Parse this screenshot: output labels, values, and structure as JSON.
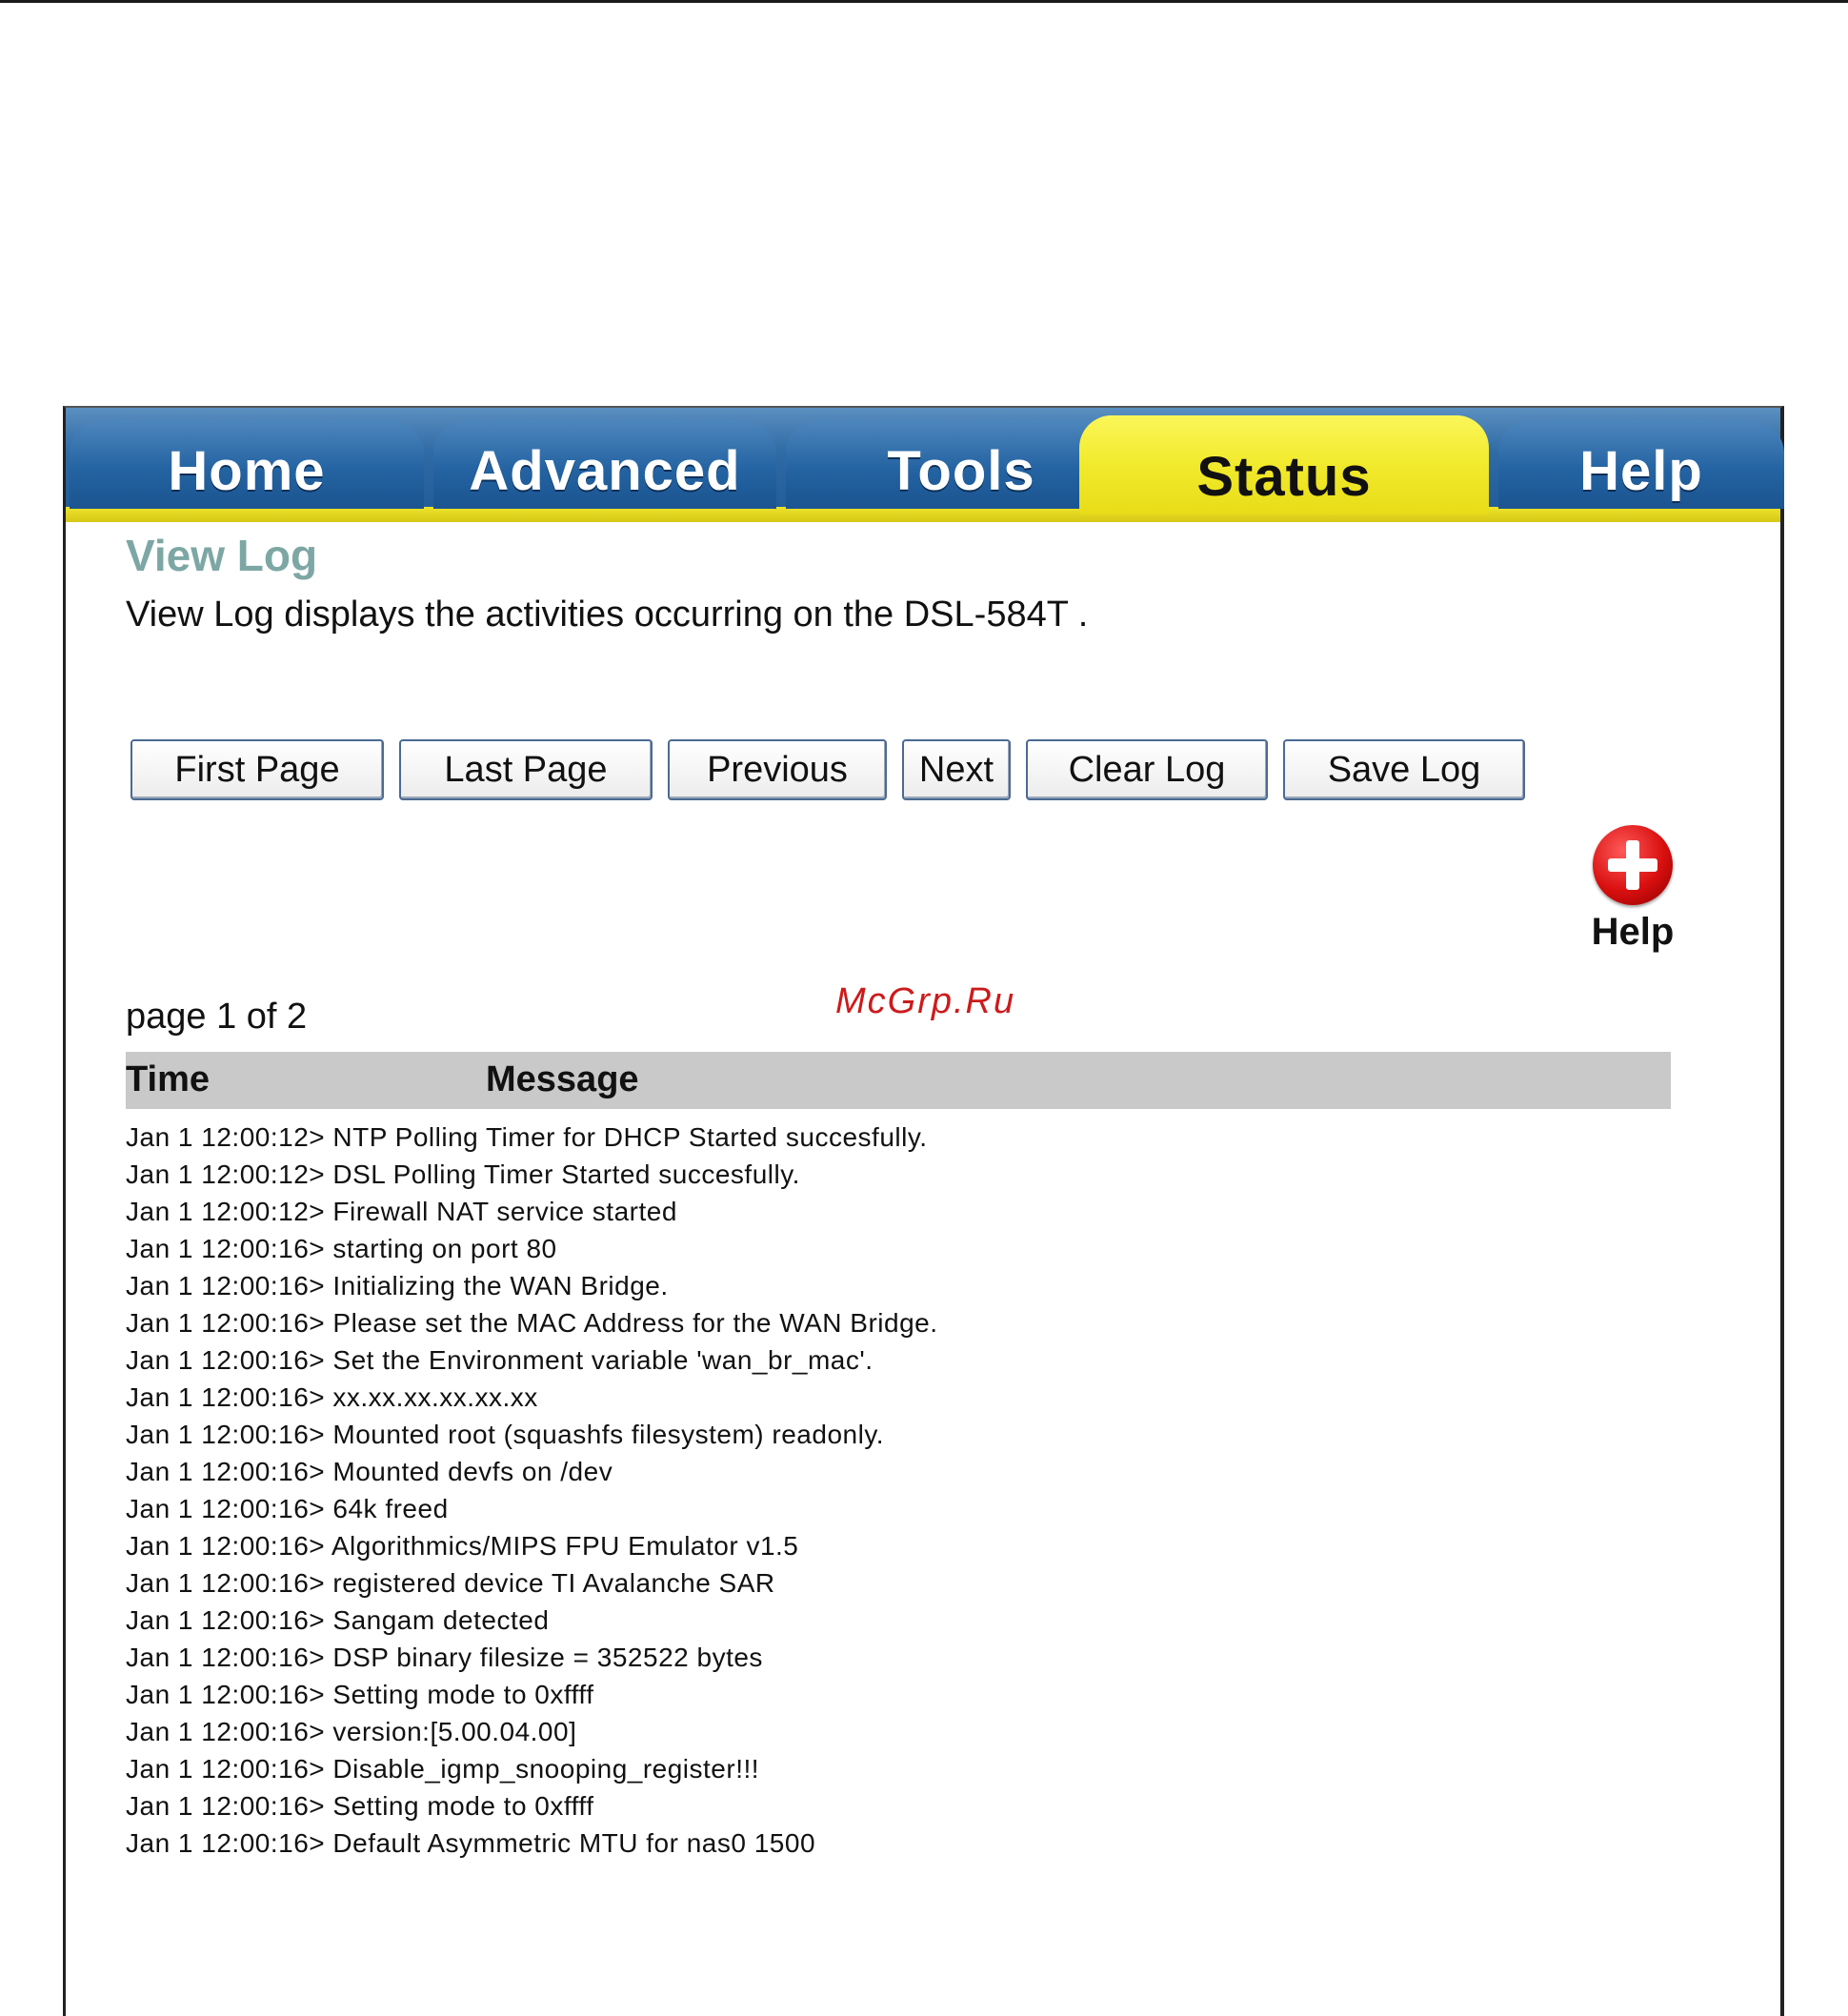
{
  "tabs": [
    {
      "label": "Home",
      "active": false
    },
    {
      "label": "Advanced",
      "active": false
    },
    {
      "label": "Tools",
      "active": false
    },
    {
      "label": "Status",
      "active": true
    },
    {
      "label": "Help",
      "active": false
    }
  ],
  "page": {
    "title": "View Log",
    "description": "View Log displays the activities occurring on the DSL-584T ."
  },
  "buttons": {
    "first_page": "First Page",
    "last_page": "Last Page",
    "previous": "Previous",
    "next": "Next",
    "clear_log": "Clear Log",
    "save_log": "Save Log"
  },
  "help": {
    "label": "Help"
  },
  "watermark": "McGrp.Ru",
  "pagination": {
    "text": "page 1 of 2"
  },
  "log": {
    "columns": [
      "Time",
      "Message"
    ],
    "rows": [
      "Jan 1 12:00:12> NTP Polling Timer for DHCP Started succesfully.",
      "Jan 1 12:00:12> DSL Polling Timer Started succesfully.",
      "Jan 1 12:00:12> Firewall NAT service started",
      "Jan 1 12:00:16> starting on port 80",
      "Jan 1 12:00:16> Initializing the WAN Bridge.",
      "Jan 1 12:00:16> Please set the MAC Address for the WAN Bridge.",
      "Jan 1 12:00:16> Set the Environment variable 'wan_br_mac'.",
      "Jan 1 12:00:16> xx.xx.xx.xx.xx.xx",
      "Jan 1 12:00:16> Mounted root (squashfs filesystem) readonly.",
      "Jan 1 12:00:16> Mounted devfs on /dev",
      "Jan 1 12:00:16> 64k freed",
      "Jan 1 12:00:16> Algorithmics/MIPS FPU Emulator v1.5",
      "Jan 1 12:00:16> registered device TI Avalanche SAR",
      "Jan 1 12:00:16> Sangam detected",
      "Jan 1 12:00:16> DSP binary filesize = 352522 bytes",
      "Jan 1 12:00:16> Setting mode to 0xffff",
      "Jan 1 12:00:16> version:[5.00.04.00]",
      "Jan 1 12:00:16> Disable_igmp_snooping_register!!!",
      "Jan 1 12:00:16> Setting mode to 0xffff",
      "Jan 1 12:00:16> Default Asymmetric MTU for nas0 1500"
    ]
  },
  "colors": {
    "tab_blue": "#2463a2",
    "tab_active_yellow": "#f1ea2c",
    "title_teal": "#7da7a4",
    "header_gray": "#c9c9c9",
    "help_red": "#d90f0f"
  }
}
